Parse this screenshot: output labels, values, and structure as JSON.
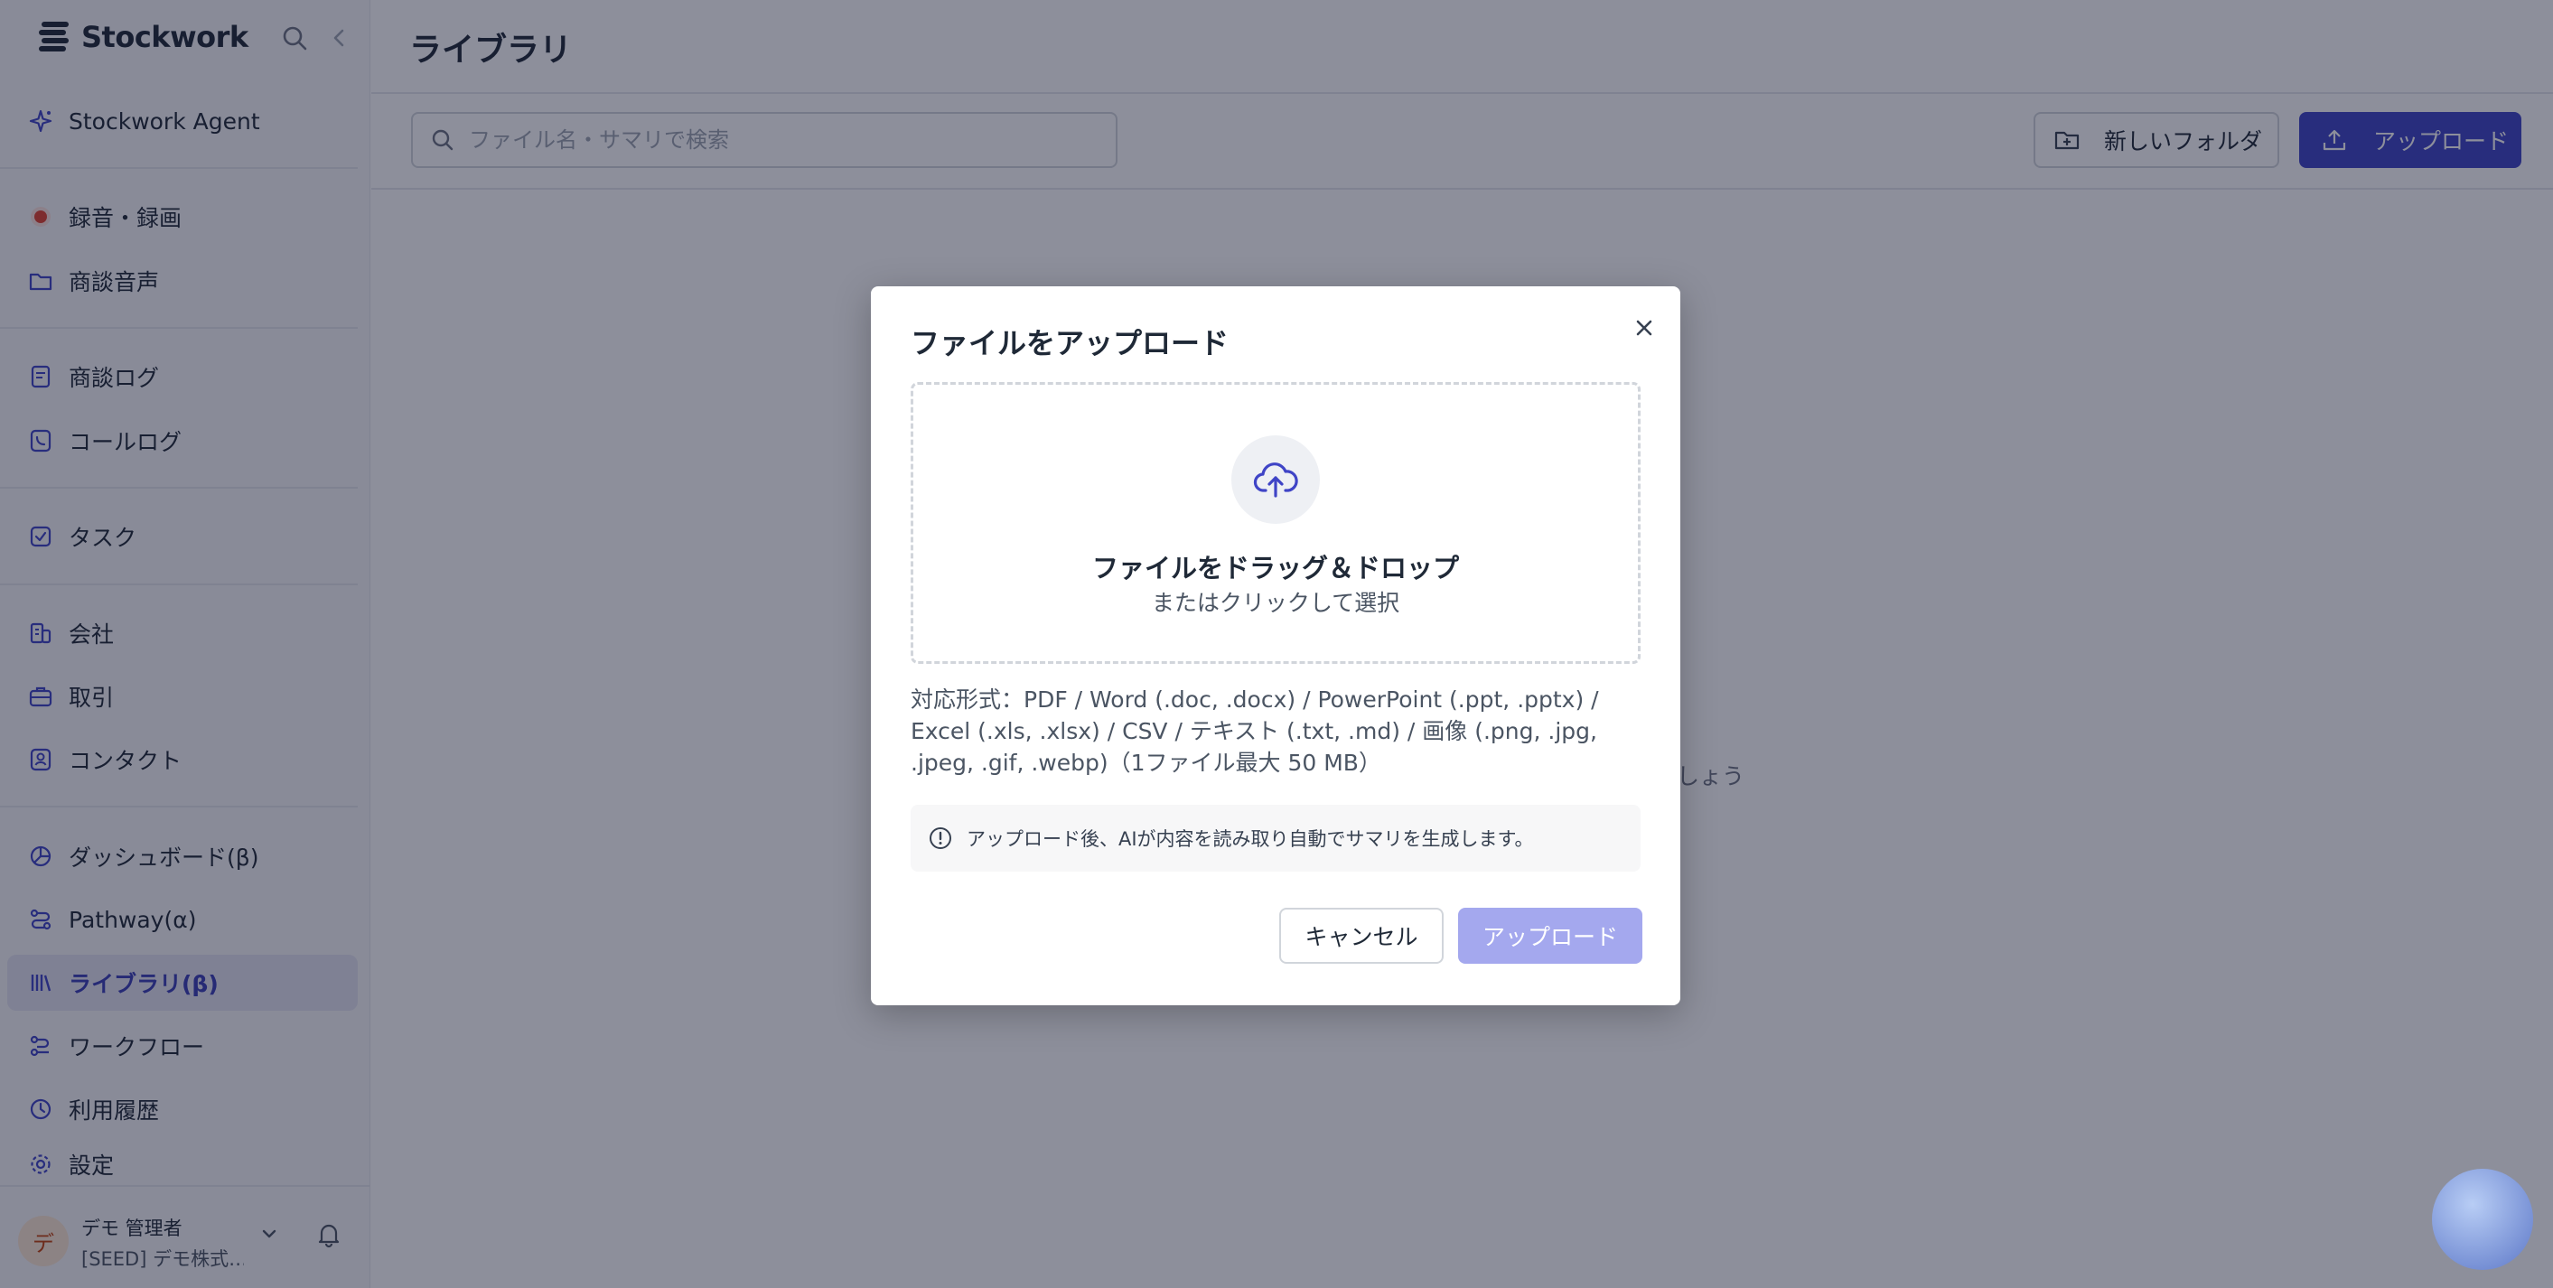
{
  "colors": {
    "accent": "#3f44c6",
    "accent_disabled": "#a4a8ee",
    "recording_dot": "#e0412f",
    "active_bg": "#e4e5f2"
  },
  "brand": {
    "name": "Stockwork"
  },
  "sidebar": {
    "items": [
      {
        "label": "Stockwork Agent",
        "icon": "sparkle-icon"
      },
      {
        "label": "録音・録画",
        "icon": "record-icon"
      },
      {
        "label": "商談音声",
        "icon": "folder-icon"
      },
      {
        "label": "商談ログ",
        "icon": "document-icon"
      },
      {
        "label": "コールログ",
        "icon": "phone-icon"
      },
      {
        "label": "タスク",
        "icon": "task-check-icon"
      },
      {
        "label": "会社",
        "icon": "building-icon"
      },
      {
        "label": "取引",
        "icon": "briefcase-icon"
      },
      {
        "label": "コンタクト",
        "icon": "contact-icon"
      },
      {
        "label": "ダッシュボード(β)",
        "icon": "chart-pie-icon"
      },
      {
        "label": "Pathway(α)",
        "icon": "route-icon"
      },
      {
        "label": "ライブラリ(β)",
        "icon": "library-icon",
        "active": true
      },
      {
        "label": "ワークフロー",
        "icon": "workflow-icon"
      },
      {
        "label": "利用履歴",
        "icon": "clock-icon"
      },
      {
        "label": "設定",
        "icon": "gear-icon"
      }
    ]
  },
  "user": {
    "initial": "デ",
    "name": "デモ 管理者",
    "org": "[SEED] デモ株式…"
  },
  "page": {
    "title": "ライブラリ",
    "search_placeholder": "ファイル名・サマリで検索",
    "new_folder_label": "新しいフォルダ",
    "upload_label": "アップロード",
    "empty_text_visible": "ましょう"
  },
  "modal": {
    "title": "ファイルをアップロード",
    "drop_title": "ファイルをドラッグ＆ドロップ",
    "drop_sub": "またはクリックして選択",
    "formats": "対応形式：PDF / Word (.doc, .docx) / PowerPoint (.ppt, .pptx) / Excel (.xls, .xlsx) / CSV / テキスト (.txt, .md) / 画像 (.png, .jpg, .jpeg, .gif, .webp)（1ファイル最大 50 MB）",
    "info": "アップロード後、AIが内容を読み取り自動でサマリを生成します。",
    "cancel_label": "キャンセル",
    "submit_label": "アップロード"
  }
}
